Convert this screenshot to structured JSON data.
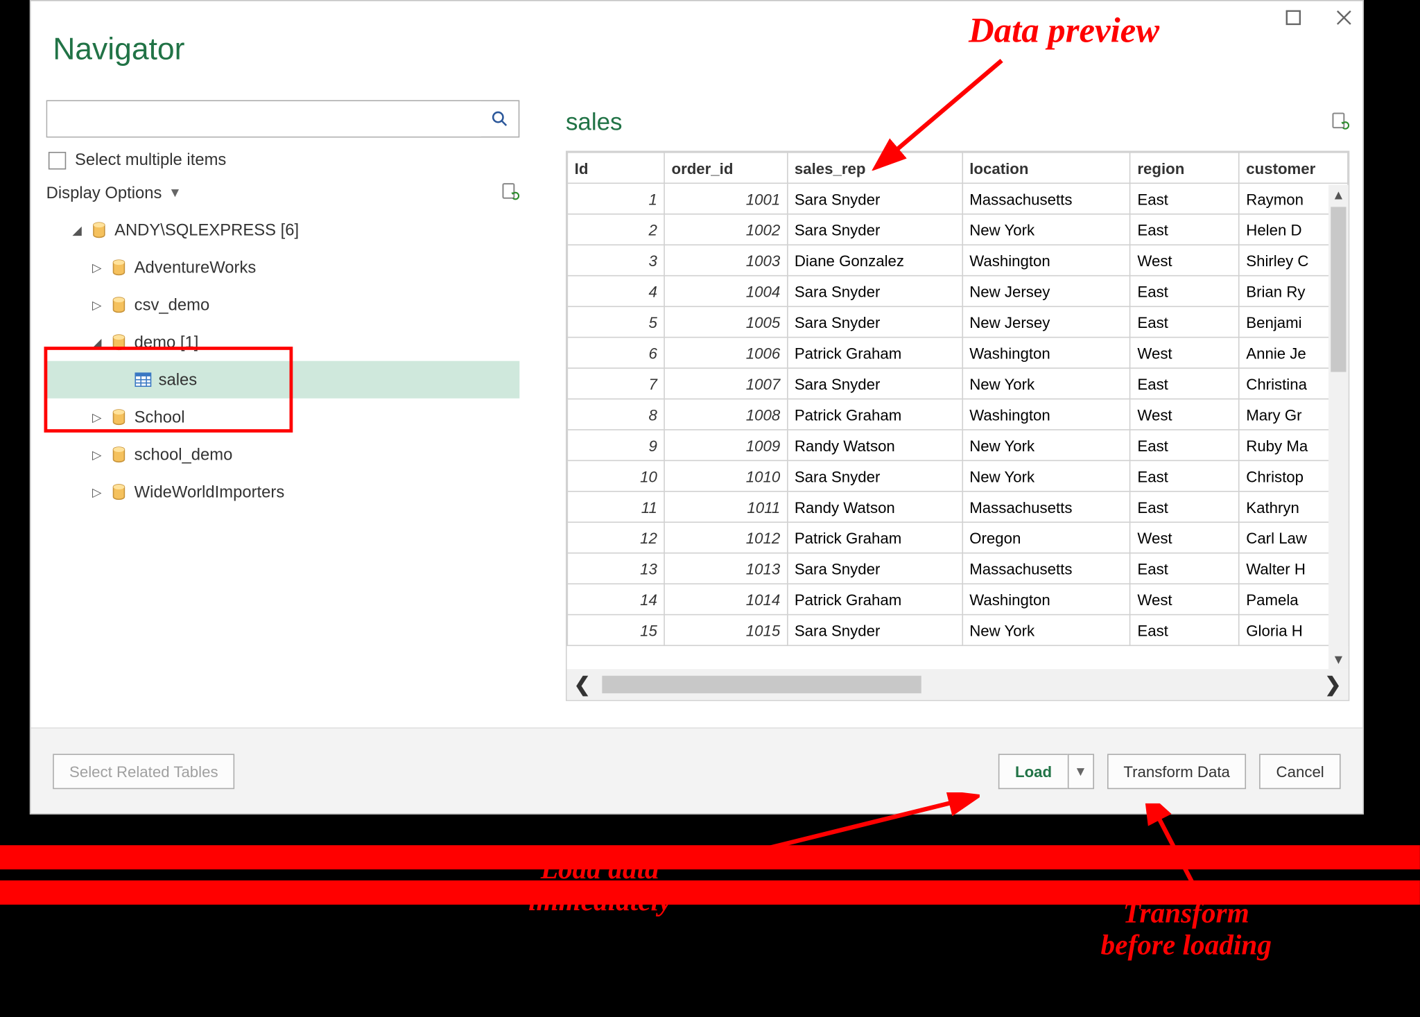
{
  "window": {
    "title": "Navigator",
    "select_multiple_label": "Select multiple items",
    "display_options_label": "Display Options",
    "search_placeholder": ""
  },
  "tree": {
    "root": "ANDY\\SQLEXPRESS [6]",
    "items": [
      {
        "label": "AdventureWorks",
        "expanded": false
      },
      {
        "label": "csv_demo",
        "expanded": false
      },
      {
        "label": "demo [1]",
        "expanded": true,
        "children": [
          {
            "label": "sales",
            "selected": true
          }
        ]
      },
      {
        "label": "School",
        "expanded": false
      },
      {
        "label": "school_demo",
        "expanded": false
      },
      {
        "label": "WideWorldImporters",
        "expanded": false
      }
    ]
  },
  "preview": {
    "title": "sales",
    "columns": [
      "Id",
      "order_id",
      "sales_rep",
      "location",
      "region",
      "customer"
    ],
    "rows": [
      {
        "Id": 1,
        "order_id": 1001,
        "sales_rep": "Sara Snyder",
        "location": "Massachusetts",
        "region": "East",
        "customer": "Raymon"
      },
      {
        "Id": 2,
        "order_id": 1002,
        "sales_rep": "Sara Snyder",
        "location": "New York",
        "region": "East",
        "customer": "Helen D"
      },
      {
        "Id": 3,
        "order_id": 1003,
        "sales_rep": "Diane Gonzalez",
        "location": "Washington",
        "region": "West",
        "customer": "Shirley C"
      },
      {
        "Id": 4,
        "order_id": 1004,
        "sales_rep": "Sara Snyder",
        "location": "New Jersey",
        "region": "East",
        "customer": "Brian Ry"
      },
      {
        "Id": 5,
        "order_id": 1005,
        "sales_rep": "Sara Snyder",
        "location": "New Jersey",
        "region": "East",
        "customer": "Benjami"
      },
      {
        "Id": 6,
        "order_id": 1006,
        "sales_rep": "Patrick Graham",
        "location": "Washington",
        "region": "West",
        "customer": "Annie Je"
      },
      {
        "Id": 7,
        "order_id": 1007,
        "sales_rep": "Sara Snyder",
        "location": "New York",
        "region": "East",
        "customer": "Christina"
      },
      {
        "Id": 8,
        "order_id": 1008,
        "sales_rep": "Patrick Graham",
        "location": "Washington",
        "region": "West",
        "customer": "Mary Gr"
      },
      {
        "Id": 9,
        "order_id": 1009,
        "sales_rep": "Randy Watson",
        "location": "New York",
        "region": "East",
        "customer": "Ruby Ma"
      },
      {
        "Id": 10,
        "order_id": 1010,
        "sales_rep": "Sara Snyder",
        "location": "New York",
        "region": "East",
        "customer": "Christop"
      },
      {
        "Id": 11,
        "order_id": 1011,
        "sales_rep": "Randy Watson",
        "location": "Massachusetts",
        "region": "East",
        "customer": "Kathryn"
      },
      {
        "Id": 12,
        "order_id": 1012,
        "sales_rep": "Patrick Graham",
        "location": "Oregon",
        "region": "West",
        "customer": "Carl Law"
      },
      {
        "Id": 13,
        "order_id": 1013,
        "sales_rep": "Sara Snyder",
        "location": "Massachusetts",
        "region": "East",
        "customer": "Walter H"
      },
      {
        "Id": 14,
        "order_id": 1014,
        "sales_rep": "Patrick Graham",
        "location": "Washington",
        "region": "West",
        "customer": "Pamela"
      },
      {
        "Id": 15,
        "order_id": 1015,
        "sales_rep": "Sara Snyder",
        "location": "New York",
        "region": "East",
        "customer": "Gloria H"
      }
    ]
  },
  "footer": {
    "select_related": "Select Related Tables",
    "load": "Load",
    "transform": "Transform Data",
    "cancel": "Cancel"
  },
  "annotations": {
    "preview": "Data preview",
    "load": "Load data\nimmediately",
    "transform": "Transform\nbefore loading"
  }
}
